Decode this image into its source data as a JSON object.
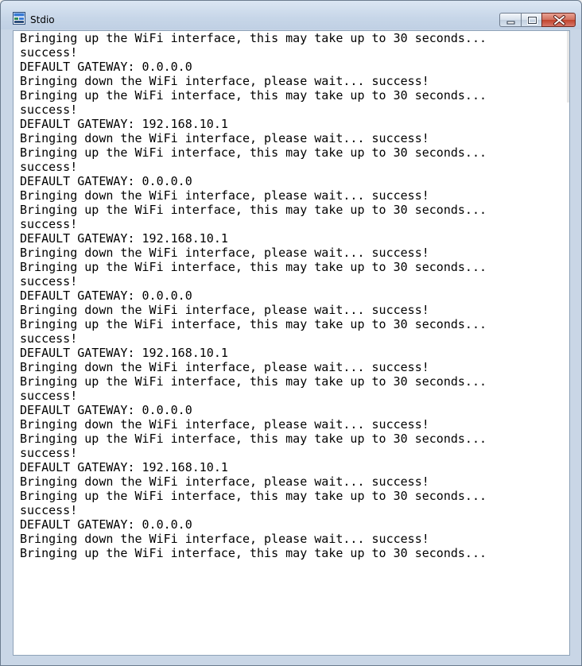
{
  "window": {
    "title": "Stdio",
    "icon": "terminal-app-icon"
  },
  "caption_buttons": {
    "minimize": "minimize-icon",
    "maximize": "maximize-icon",
    "close": "close-icon"
  },
  "console": {
    "lines": [
      "Bringing up the WiFi interface, this may take up to 30 seconds...",
      "success!",
      "DEFAULT GATEWAY: 0.0.0.0",
      "Bringing down the WiFi interface, please wait... success!",
      "Bringing up the WiFi interface, this may take up to 30 seconds...",
      "success!",
      "DEFAULT GATEWAY: 192.168.10.1",
      "Bringing down the WiFi interface, please wait... success!",
      "Bringing up the WiFi interface, this may take up to 30 seconds...",
      "success!",
      "DEFAULT GATEWAY: 0.0.0.0",
      "Bringing down the WiFi interface, please wait... success!",
      "Bringing up the WiFi interface, this may take up to 30 seconds...",
      "success!",
      "DEFAULT GATEWAY: 192.168.10.1",
      "Bringing down the WiFi interface, please wait... success!",
      "Bringing up the WiFi interface, this may take up to 30 seconds...",
      "success!",
      "DEFAULT GATEWAY: 0.0.0.0",
      "Bringing down the WiFi interface, please wait... success!",
      "Bringing up the WiFi interface, this may take up to 30 seconds...",
      "success!",
      "DEFAULT GATEWAY: 192.168.10.1",
      "Bringing down the WiFi interface, please wait... success!",
      "Bringing up the WiFi interface, this may take up to 30 seconds...",
      "success!",
      "DEFAULT GATEWAY: 0.0.0.0",
      "Bringing down the WiFi interface, please wait... success!",
      "Bringing up the WiFi interface, this may take up to 30 seconds...",
      "success!",
      "DEFAULT GATEWAY: 192.168.10.1",
      "Bringing down the WiFi interface, please wait... success!",
      "Bringing up the WiFi interface, this may take up to 30 seconds...",
      "success!",
      "DEFAULT GATEWAY: 0.0.0.0",
      "Bringing down the WiFi interface, please wait... success!",
      "Bringing up the WiFi interface, this may take up to 30 seconds..."
    ]
  }
}
